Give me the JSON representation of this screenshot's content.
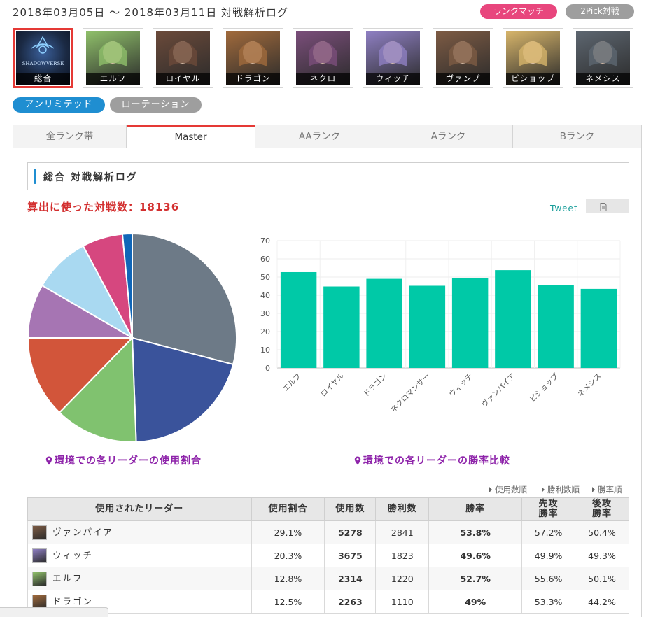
{
  "header": {
    "title": "2018年03月05日 ～ 2018年03月11日 対戦解析ログ",
    "mode_buttons": [
      "ランクマッチ",
      "2Pick対戦"
    ]
  },
  "leaders": [
    {
      "label": "総合",
      "icon": "shadowverse-logo-icon",
      "color": "#1b2a44"
    },
    {
      "label": "エルフ",
      "icon": "elf-portrait-icon",
      "color": "#8fbf6a"
    },
    {
      "label": "ロイヤル",
      "icon": "royal-portrait-icon",
      "color": "#6b4a3a"
    },
    {
      "label": "ドラゴン",
      "icon": "dragon-portrait-icon",
      "color": "#a06a3c"
    },
    {
      "label": "ネクロ",
      "icon": "necro-portrait-icon",
      "color": "#7a4e7a"
    },
    {
      "label": "ウィッチ",
      "icon": "witch-portrait-icon",
      "color": "#8e7fc2"
    },
    {
      "label": "ヴァンプ",
      "icon": "vampire-portrait-icon",
      "color": "#7d5b44"
    },
    {
      "label": "ビショップ",
      "icon": "bishop-portrait-icon",
      "color": "#d6b46a"
    },
    {
      "label": "ネメシス",
      "icon": "nemesis-portrait-icon",
      "color": "#5d6670"
    }
  ],
  "formats": [
    "アンリミテッド",
    "ローテーション"
  ],
  "tabs": [
    "全ランク帯",
    "Master",
    "AAランク",
    "Aランク",
    "Bランク"
  ],
  "section_title": "総合 対戦解析ログ",
  "match_count": "算出に使った対戦数：18136",
  "tweet_label": "Tweet",
  "captions": {
    "pie": "環境での各リーダーの使用割合",
    "bar": "環境での各リーダーの勝率比較"
  },
  "sort_links": [
    "使用数順",
    "勝利数順",
    "勝率順"
  ],
  "table": {
    "headers": [
      "使用されたリーダー",
      "使用割合",
      "使用数",
      "勝利数",
      "勝率",
      "先攻勝率",
      "後攻勝率"
    ],
    "rows": [
      {
        "leader": "ヴァンパイア",
        "share": "29.1%",
        "uses": "5278",
        "wins": "2841",
        "rate": "53.8%",
        "first": "57.2%",
        "second": "50.4%",
        "highlight": true,
        "color": "#7d5b44"
      },
      {
        "leader": "ウィッチ",
        "share": "20.3%",
        "uses": "3675",
        "wins": "1823",
        "rate": "49.6%",
        "first": "49.9%",
        "second": "49.3%",
        "highlight": false,
        "color": "#8e7fc2"
      },
      {
        "leader": "エルフ",
        "share": "12.8%",
        "uses": "2314",
        "wins": "1220",
        "rate": "52.7%",
        "first": "55.6%",
        "second": "50.1%",
        "highlight": true,
        "color": "#8fbf6a"
      },
      {
        "leader": "ドラゴン",
        "share": "12.5%",
        "uses": "2263",
        "wins": "1110",
        "rate": "49%",
        "first": "53.3%",
        "second": "44.2%",
        "highlight": false,
        "color": "#a06a3c"
      }
    ]
  },
  "chart_data": [
    {
      "type": "pie",
      "title": "",
      "slices": [
        {
          "label": "ヴァンパイア",
          "value": 29.1,
          "color": "#6d7a87"
        },
        {
          "label": "ウィッチ",
          "value": 20.3,
          "color": "#3a539b"
        },
        {
          "label": "",
          "value": 12.9,
          "color": "#80c26f"
        },
        {
          "label": "",
          "value": 12.7,
          "color": "#d2553a"
        },
        {
          "label": "",
          "value": 8.4,
          "color": "#a675b3"
        },
        {
          "label": "",
          "value": 8.8,
          "color": "#a9d9f1"
        },
        {
          "label": "",
          "value": 6.3,
          "color": "#d6477f"
        },
        {
          "label": "",
          "value": 1.5,
          "color": "#1066b8"
        }
      ]
    },
    {
      "type": "bar",
      "title": "",
      "categories": [
        "エルフ",
        "ロイヤル",
        "ドラゴン",
        "ネクロマンサー",
        "ウィッチ",
        "ヴァンパイア",
        "ビショップ",
        "ネメシス"
      ],
      "values": [
        52.7,
        44.8,
        49.0,
        45.2,
        49.6,
        53.8,
        45.4,
        43.5
      ],
      "ylim": [
        0,
        70
      ],
      "yticks": [
        0,
        10,
        20,
        30,
        40,
        50,
        60,
        70
      ],
      "color": "#00c9a7",
      "grid": true
    }
  ]
}
